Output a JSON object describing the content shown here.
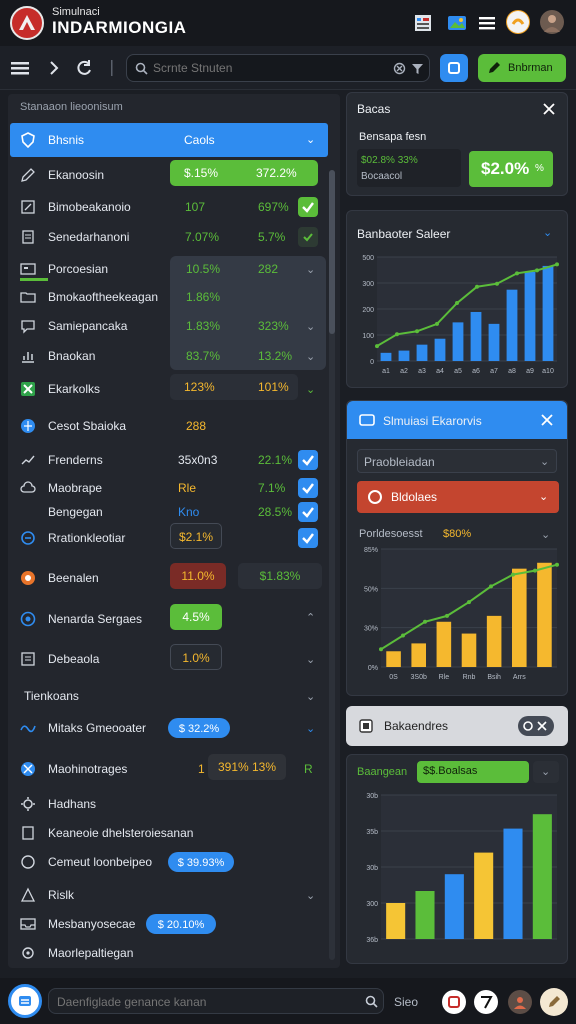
{
  "app": {
    "subtitle": "Simulnaci",
    "title": "INDARMIONGIA"
  },
  "toolbar": {
    "search_placeholder": "Scrnte Stnuten",
    "green_button": "Bnbrman"
  },
  "left": {
    "header": "Stanaaon lieoonisum",
    "selected": {
      "label": "Bhsnis",
      "col": "Caols"
    },
    "rows": [
      {
        "label": "Ekanoosin",
        "v1": "$.15%",
        "v2": "372.2%"
      },
      {
        "label": "Bimobeakanoio",
        "v1": "107",
        "v2": "697%"
      },
      {
        "label": "Senedarhanoni",
        "v1": "7.07%",
        "v2": "5.7%"
      },
      {
        "label": "Porcoesian",
        "v1": "10.5%",
        "v2": "282"
      },
      {
        "label": "Bmokaoftheekeagan",
        "v1": "1.86%"
      },
      {
        "label": "Samiepancaka",
        "v1": "1.83%",
        "v2": "323%"
      },
      {
        "label": "Bnaokan",
        "v1": "83.7%",
        "v2": "13.2%"
      },
      {
        "label": "Ekarkolks",
        "v1": "123%",
        "v2": "101%"
      },
      {
        "label": "Cesot Sbaioka",
        "v1": "288"
      },
      {
        "label": "Frenderns",
        "v1": "35x0n3",
        "v2": "22.1%"
      },
      {
        "label": "Maobrape",
        "v1": "Rle",
        "v2": "7.1%"
      },
      {
        "label": "Bengegan",
        "v1": "Kno",
        "v2": "28.5%"
      },
      {
        "label": "Rrationkleotiar",
        "v1": "$2.1%"
      },
      {
        "label": "Beenalen",
        "v1": "11.0%",
        "v2": "$1.83%"
      },
      {
        "label": "Nenarda Sergaes",
        "v1": "4.5%"
      },
      {
        "label": "Debeaola",
        "v1": "1.0%"
      },
      {
        "label": "Tienkoans"
      },
      {
        "label": "Mitaks Gmeooater",
        "v1": "$ 32.2%"
      },
      {
        "label": "Maohinotrages",
        "v0": "1",
        "v1": "391% 13%",
        "v2": "R"
      },
      {
        "label": "Hadhans"
      },
      {
        "label": "Keaneoie dhelsteroiesanan"
      },
      {
        "label": "Cemeut loonbeipeo",
        "v1": "$ 39.93%"
      },
      {
        "label": "Rislk"
      },
      {
        "label": "Mesbanyosecae",
        "v1": "$ 20.10%"
      },
      {
        "label": "Maorlepaltiegan"
      }
    ]
  },
  "cards": {
    "c1": {
      "title": "Bacas",
      "subtitle": "Bensapa fesn",
      "line1": "$02.8% 33%",
      "line2": "Bocaacol",
      "kpi": "$2.0%",
      "kpi_sub": "%"
    },
    "c2": {
      "title": "Banbaoter Saleer"
    },
    "c3": {
      "title": "Slmuiasi Ekarorvis",
      "field": "Praobleiadan",
      "select": "Bldolaes",
      "sub": "Porldesoesst",
      "sub_val": "$80%"
    },
    "c4": {
      "title": "Bakaendres"
    },
    "c5": {
      "title": "Baangean",
      "tag": "$$.Boalsas"
    }
  },
  "bottom": {
    "search_placeholder": "Daenfiglade genance kanan",
    "label": "Sieo"
  },
  "chart_data": [
    {
      "type": "bar",
      "title": "Banbaoter Saleer",
      "categories": [
        "a1",
        "a2",
        "a3",
        "a4",
        "a5",
        "a6",
        "a7",
        "a8",
        "a9",
        "a10"
      ],
      "values": [
        55,
        70,
        110,
        150,
        260,
        330,
        250,
        480,
        600,
        640
      ],
      "ylim": [
        0,
        700
      ],
      "yticks": [
        "500",
        "300",
        "200",
        "100",
        "0"
      ],
      "line": [
        100,
        180,
        200,
        250,
        390,
        500,
        520,
        590,
        610,
        650
      ],
      "colors": {
        "bars": "#2f8cf0",
        "line": "#5bbd3a"
      }
    },
    {
      "type": "bar",
      "categories": [
        "0S",
        "3S0b",
        "Rle",
        "Rnb",
        "Bsih",
        "Arrs"
      ],
      "values": [
        80,
        120,
        230,
        170,
        260,
        500,
        530
      ],
      "ylim": [
        0,
        600
      ],
      "yticks": [
        "85%",
        "50%",
        "30%",
        "0%"
      ],
      "line": [
        90,
        160,
        230,
        260,
        330,
        410,
        470,
        490,
        520
      ],
      "colors": {
        "bars": "#f5b82e",
        "line": "#5bbd3a"
      }
    },
    {
      "type": "bar",
      "values": [
        150,
        200,
        270,
        360,
        460,
        520
      ],
      "colors_per_bar": [
        "#f5c535",
        "#5bbd3a",
        "#2f8cf0",
        "#f5c535",
        "#2f8cf0",
        "#5bbd3a"
      ],
      "ylim": [
        0,
        600
      ],
      "yticks": [
        "30b",
        "35b",
        "30b",
        "300",
        "36b"
      ]
    }
  ]
}
